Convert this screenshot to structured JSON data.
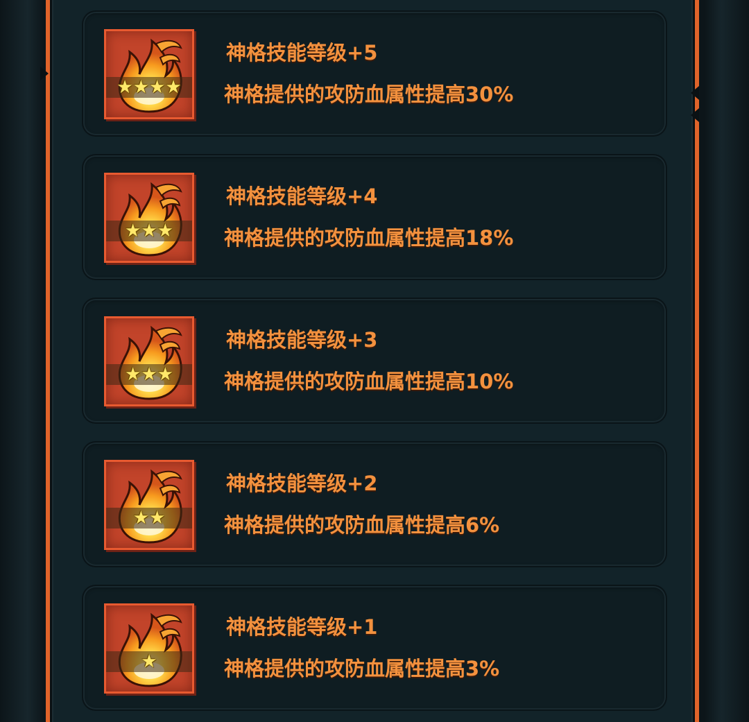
{
  "colors": {
    "panel_border": "#e0642a",
    "card_bg": "#0f1d22",
    "text_orange": "#f3913e",
    "icon_bg": "#c2442a",
    "star": "#ffe86a"
  },
  "icon_name": "fire-emblem-icon",
  "tiers": [
    {
      "title": "神格技能等级+5",
      "desc": "神格提供的攻防血属性提高30%",
      "stars": 4
    },
    {
      "title": "神格技能等级+4",
      "desc": "神格提供的攻防血属性提高18%",
      "stars": 3
    },
    {
      "title": "神格技能等级+3",
      "desc": "神格提供的攻防血属性提高10%",
      "stars": 3
    },
    {
      "title": "神格技能等级+2",
      "desc": "神格提供的攻防血属性提高6%",
      "stars": 2
    },
    {
      "title": "神格技能等级+1",
      "desc": "神格提供的攻防血属性提高3%",
      "stars": 1
    }
  ]
}
